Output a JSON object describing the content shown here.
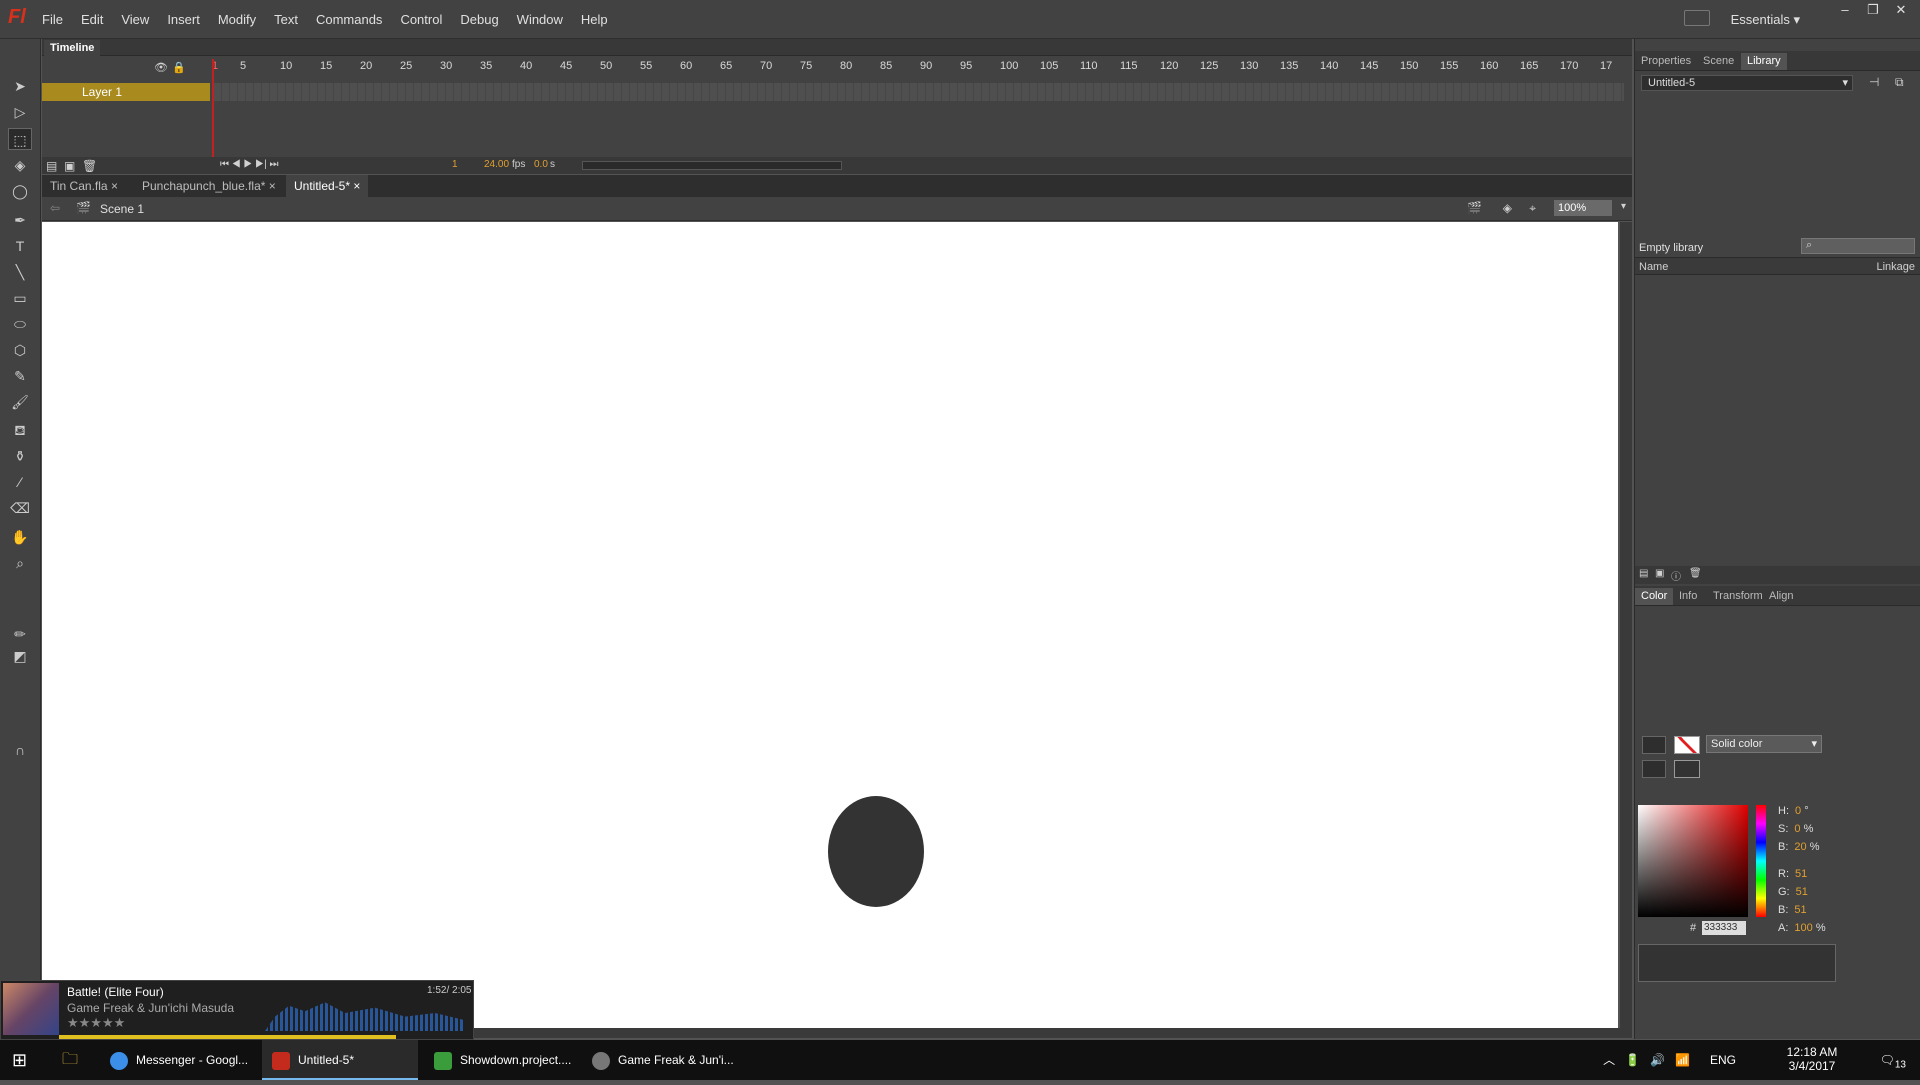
{
  "app": {
    "logo": "Fl",
    "workspace": "Essentials"
  },
  "menu": [
    "File",
    "Edit",
    "View",
    "Insert",
    "Modify",
    "Text",
    "Commands",
    "Control",
    "Debug",
    "Window",
    "Help"
  ],
  "window_buttons": [
    "–",
    "❐",
    "✕"
  ],
  "timeline": {
    "tab": "Timeline",
    "frame_numbers": [
      "1",
      "5",
      "10",
      "15",
      "20",
      "25",
      "30",
      "35",
      "40",
      "45",
      "50",
      "55",
      "60",
      "65",
      "70",
      "75",
      "80",
      "85",
      "90",
      "95",
      "100",
      "105",
      "110",
      "115",
      "120",
      "125",
      "130",
      "135",
      "140",
      "145",
      "150",
      "155",
      "160",
      "165",
      "170",
      "17"
    ],
    "layer_name": "Layer 1",
    "current_frame": "1",
    "fps": "24.00",
    "fps_unit": "fps",
    "time": "0.0",
    "time_unit": "s"
  },
  "doc_tabs": [
    {
      "label": "Tin Can.fla"
    },
    {
      "label": "Punchapunch_blue.fla*"
    },
    {
      "label": "Untitled-5*"
    }
  ],
  "scene": {
    "label": "Scene 1",
    "zoom": "100%"
  },
  "stage": {
    "shape_color": "#333333",
    "background": "#ffffff"
  },
  "right_tabs": [
    "Properties",
    "Scene",
    "Library"
  ],
  "library": {
    "document": "Untitled-5",
    "status": "Empty library",
    "col_name": "Name",
    "col_linkage": "Linkage"
  },
  "color_tabs": [
    "Color",
    "Info",
    "Transform",
    "Align"
  ],
  "color": {
    "type": "Solid color",
    "H": "0",
    "H_unit": "°",
    "S": "0",
    "S_unit": "%",
    "B": "20",
    "B_unit": "%",
    "R": "51",
    "G": "51",
    "Bl": "51",
    "A": "100",
    "A_unit": "%",
    "hex_label": "#",
    "hex": "333333",
    "labels": {
      "H": "H:",
      "S": "S:",
      "B": "B:",
      "R": "R:",
      "G": "G:",
      "Bl": "B:",
      "A": "A:"
    }
  },
  "media": {
    "title": "Battle! (Elite Four)",
    "artist": "Game Freak & Jun'ichi Masuda",
    "time": "1:52/ 2:05",
    "stars": "★★★★★",
    "progress": 0.9
  },
  "taskbar": {
    "apps": [
      {
        "label": "Messenger - Googl..."
      },
      {
        "label": "Untitled-5*"
      },
      {
        "label": "Showdown.project...."
      },
      {
        "label": "Game Freak & Jun'i..."
      }
    ],
    "lang": "ENG",
    "clock_time": "12:18 AM",
    "clock_date": "3/4/2017",
    "notifications": "13"
  }
}
